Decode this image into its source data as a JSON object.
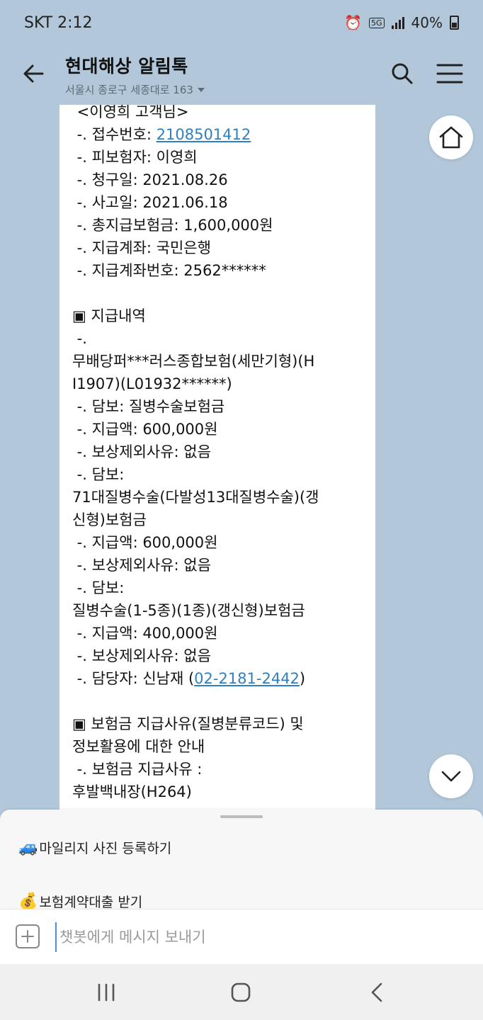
{
  "status": {
    "carrier_time": "SKT 2:12",
    "network": "5G",
    "battery": "40%"
  },
  "header": {
    "title": "현대해상 알림톡",
    "subtitle": "서울시 종로구 세종대로 163"
  },
  "message": {
    "lines": [
      {
        "text": " <이영희 고객님>"
      },
      {
        "text": " -. 접수번호: ",
        "link": "2108501412"
      },
      {
        "text": " -. 피보험자: 이영희"
      },
      {
        "text": " -. 청구일: 2021.08.26"
      },
      {
        "text": " -. 사고일: 2021.06.18"
      },
      {
        "text": " -. 총지급보험금: 1,600,000원"
      },
      {
        "text": " -. 지급계좌: 국민은행"
      },
      {
        "text": " -. 지급계좌번호: 2562******"
      },
      {
        "text": ""
      },
      {
        "text": "▣ 지급내역"
      },
      {
        "text": " -."
      },
      {
        "text": "무배당퍼***러스종합보험(세만기형)(H"
      },
      {
        "text": "I1907)(L01932******)"
      },
      {
        "text": " -. 담보: 질병수술보험금"
      },
      {
        "text": " -. 지급액: 600,000원"
      },
      {
        "text": " -. 보상제외사유: 없음"
      },
      {
        "text": " -. 담보:"
      },
      {
        "text": "71대질병수술(다발성13대질병수술)(갱"
      },
      {
        "text": "신형)보험금"
      },
      {
        "text": " -. 지급액: 600,000원"
      },
      {
        "text": " -. 보상제외사유: 없음"
      },
      {
        "text": " -. 담보:"
      },
      {
        "text": "질병수술(1-5종)(1종)(갱신형)보험금"
      },
      {
        "text": " -. 지급액: 400,000원"
      },
      {
        "text": " -. 보상제외사유: 없음"
      },
      {
        "text": " -. 담당자: 신남재 (",
        "link": "02-2181-2442",
        "after": ")"
      },
      {
        "text": ""
      },
      {
        "text": "▣ 보험금 지급사유(질병분류코드) 및"
      },
      {
        "text": "정보활용에 대한 안내"
      },
      {
        "text": " -. 보험금 지급사유 :"
      },
      {
        "text": "후발백내장(H264)"
      }
    ]
  },
  "quick_menu": {
    "item1": "마일리지 사진 등록하기",
    "item2": "보험계약대출 받기"
  },
  "input": {
    "placeholder": "챗봇에게 메시지 보내기"
  }
}
